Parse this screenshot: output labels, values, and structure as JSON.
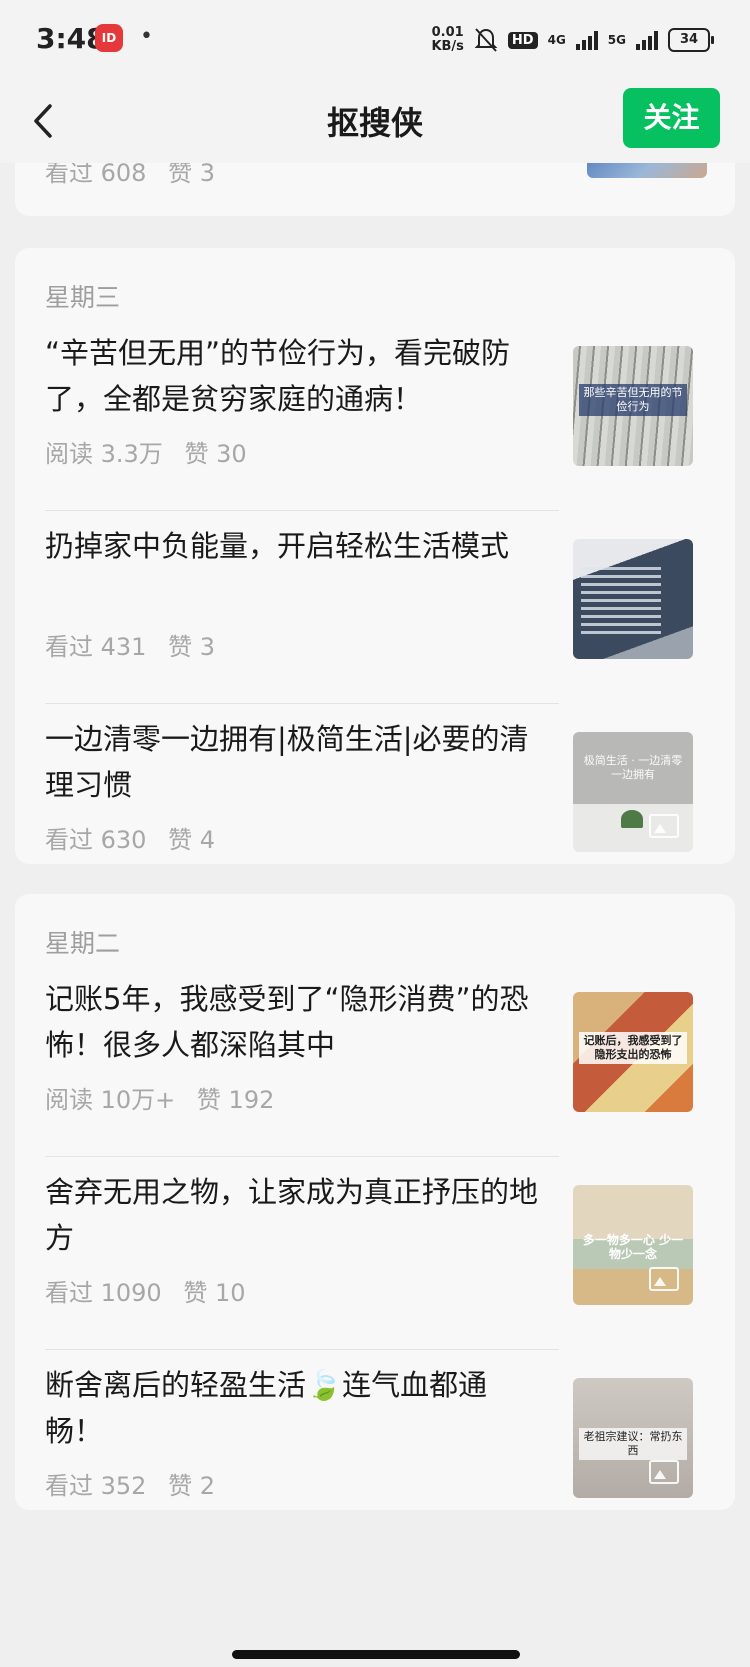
{
  "status_bar": {
    "time": "3:48",
    "app_badge": "ID",
    "dot": "•",
    "speed_value": "0.01",
    "speed_unit": "KB/s",
    "hd_label": "HD",
    "net1": "4G",
    "net2": "5G",
    "battery": "34"
  },
  "nav": {
    "title": "抠搜侠",
    "follow_label": "关注"
  },
  "top_partial_meta": {
    "views": "看过 608",
    "likes": "赞 3"
  },
  "sections": [
    {
      "day": "星期三",
      "articles": [
        {
          "title": "“辛苦但无用”的节俭行为，看完破防了，全都是贫穷家庭的通病！",
          "views": "阅读 3.3万",
          "likes": "赞 30",
          "thumb_caption": "那些辛苦但无用的节俭行为"
        },
        {
          "title": "扔掉家中负能量，开启轻松生活模式",
          "views": "看过 431",
          "likes": "赞 3",
          "thumb_caption": ""
        },
        {
          "title": "一边清零一边拥有|极简生活|必要的清理习惯",
          "views": "看过 630",
          "likes": "赞 4",
          "thumb_caption": "极简生活 · 一边清零一边拥有"
        }
      ]
    },
    {
      "day": "星期二",
      "articles": [
        {
          "title": "记账5年，我感受到了“隐形消费”的恐怖！很多人都深陷其中",
          "views": "阅读 10万+",
          "likes": "赞 192",
          "thumb_caption": "记账后，我感受到了 隐形支出的恐怖"
        },
        {
          "title": "舍弃无用之物，让家成为真正抒压的地方",
          "views": "看过 1090",
          "likes": "赞 10",
          "thumb_caption": "多一物多一心 少一物少一念"
        },
        {
          "title": "断舍离后的轻盈生活🍃连气血都通畅！",
          "views": "看过 352",
          "likes": "赞 2",
          "thumb_caption": "老祖宗建议：常扔东西"
        }
      ]
    }
  ],
  "colors": {
    "accent": "#07c160",
    "meta_text": "#a7a7a7",
    "card_bg": "#f8f8f8",
    "page_bg": "#efefef"
  },
  "icons": {
    "back": "chevron-left-icon",
    "mute": "bell-off-icon",
    "image_placeholder": "image-icon"
  }
}
